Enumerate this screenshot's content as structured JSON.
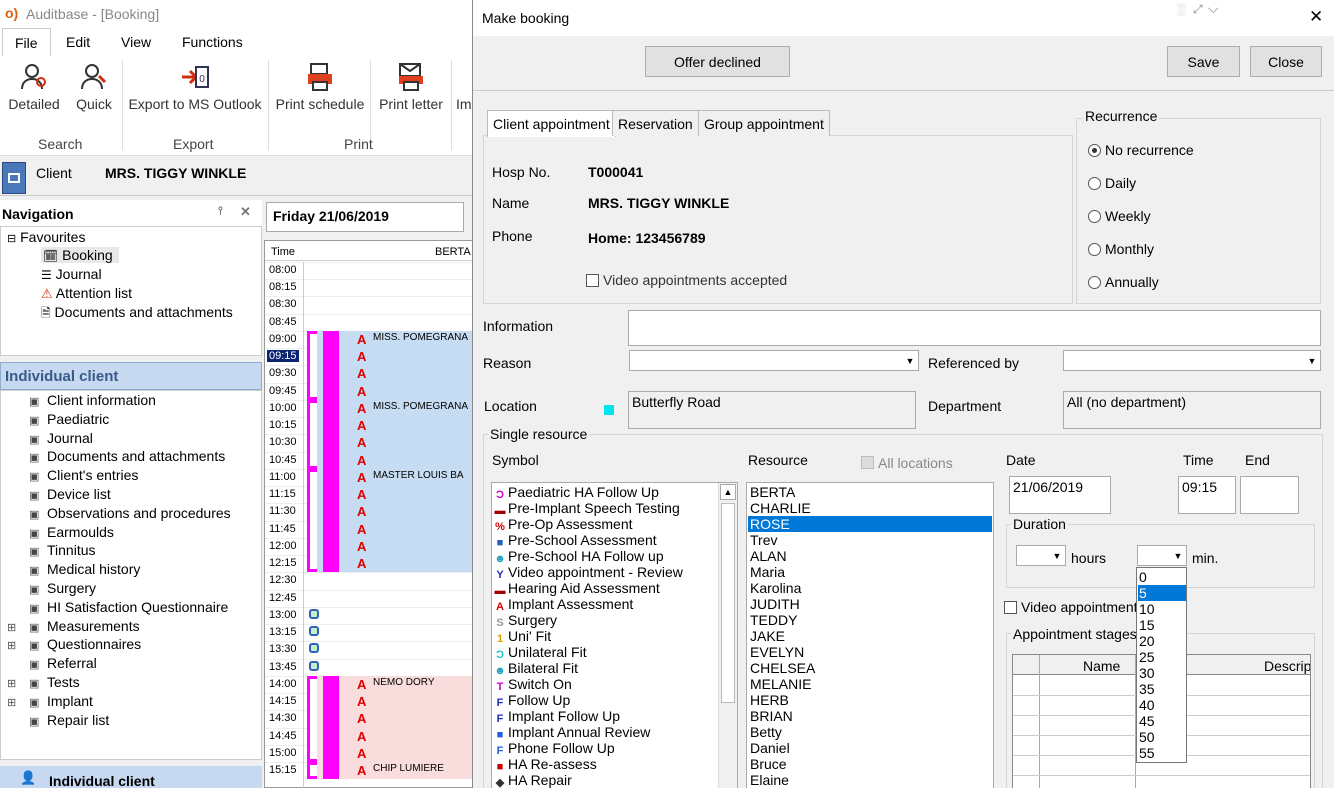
{
  "app": {
    "title": "Auditbase - [Booking]",
    "tabs": [
      "File",
      "Edit",
      "View",
      "Functions"
    ],
    "ribbon": {
      "buttons": [
        {
          "label": "Detailed",
          "icon": "person-search-icon"
        },
        {
          "label": "Quick",
          "icon": "person-quick-search-icon"
        },
        {
          "label": "Export to MS Outlook",
          "icon": "outlook-export-icon"
        },
        {
          "label": "Print schedule",
          "icon": "print-schedule-icon"
        },
        {
          "label": "Print letter",
          "icon": "print-letter-icon"
        },
        {
          "label": "Im",
          "icon": "import-icon"
        }
      ],
      "groups": [
        "Search",
        "Export",
        "Print"
      ]
    },
    "client_label": "Client",
    "client_name": "MRS. TIGGY WINKLE",
    "navigation_title": "Navigation",
    "favourites": {
      "label": "Favourites",
      "items": [
        "Booking",
        "Journal",
        "Attention list",
        "Documents and attachments"
      ]
    },
    "individual_client_title": "Individual client",
    "individual_items": [
      "Client information",
      "Paediatric",
      "Journal",
      "Documents and attachments",
      "Client's entries",
      "Device list",
      "Observations and procedures",
      "Earmoulds",
      "Tinnitus",
      "Medical history",
      "Surgery",
      "HI Satisfaction Questionnaire",
      "Measurements",
      "Questionnaires",
      "Referral",
      "Tests",
      "Implant",
      "Repair list"
    ],
    "footer_label": "Individual client",
    "schedule": {
      "date": "Friday 21/06/2019",
      "time_header": "Time",
      "resource_header": "BERTA",
      "times": [
        "08:00",
        "08:15",
        "08:30",
        "08:45",
        "09:00",
        "09:15",
        "09:30",
        "09:45",
        "10:00",
        "10:15",
        "10:30",
        "10:45",
        "11:00",
        "11:15",
        "11:30",
        "11:45",
        "12:00",
        "12:15",
        "12:30",
        "12:45",
        "13:00",
        "13:15",
        "13:30",
        "13:45",
        "14:00",
        "14:15",
        "14:30",
        "14:45",
        "15:00",
        "15:15"
      ],
      "selected_time": "09:15",
      "appointments": [
        {
          "name": "MISS. POMEGRANA",
          "start": 4,
          "len": 4,
          "color": "#c6dcf2"
        },
        {
          "name": "MISS. POMEGRANA",
          "start": 8,
          "len": 4,
          "color": "#c6dcf2"
        },
        {
          "name": "MASTER LOUIS BA",
          "start": 12,
          "len": 6,
          "color": "#c6dcf2"
        },
        {
          "name": "NEMO DORY",
          "start": 24,
          "len": 5,
          "color": "#f9dcdc"
        },
        {
          "name": "CHIP LUMIERE",
          "start": 29,
          "len": 1,
          "color": "#f9dcdc"
        }
      ]
    }
  },
  "dialog": {
    "title": "Make booking",
    "offer_declined": "Offer declined",
    "save": "Save",
    "close": "Close",
    "tabs": [
      "Client appointment",
      "Reservation",
      "Group appointment"
    ],
    "hosp_no_label": "Hosp No.",
    "hosp_no": "T000041",
    "name_label": "Name",
    "name": "MRS. TIGGY WINKLE",
    "phone_label": "Phone",
    "phone": "Home: 123456789",
    "video_accepted": "Video appointments accepted",
    "recurrence": {
      "title": "Recurrence",
      "options": [
        "No recurrence",
        "Daily",
        "Weekly",
        "Monthly",
        "Annually"
      ],
      "selected": "No recurrence"
    },
    "information_label": "Information",
    "information": "",
    "reason_label": "Reason",
    "reason": "",
    "referenced_by_label": "Referenced by",
    "referenced_by": "",
    "location_label": "Location",
    "location": "Butterfly Road",
    "location_color": "#00e5f0",
    "department_label": "Department",
    "department": "All (no department)",
    "single_resource_label": "Single resource",
    "symbol_label": "Symbol",
    "symbols": [
      {
        "label": "Paediatric HA Follow Up",
        "glyph": "Ɔ",
        "color": "#d000d0"
      },
      {
        "label": "Pre-Implant Speech Testing",
        "glyph": "▬",
        "color": "#a00000"
      },
      {
        "label": "Pre-Op Assessment",
        "glyph": "%",
        "color": "#d00000"
      },
      {
        "label": "Pre-School Assessment",
        "glyph": "■",
        "color": "#2060c0"
      },
      {
        "label": "Pre-School HA Follow up",
        "glyph": "☻",
        "color": "#20a0c0"
      },
      {
        "label": "Video appointment - Review",
        "glyph": "Y",
        "color": "#2030c0"
      },
      {
        "label": "Hearing Aid Assessment",
        "glyph": "▬",
        "color": "#a00000"
      },
      {
        "label": "Implant Assessment",
        "glyph": "A",
        "color": "#e00000"
      },
      {
        "label": "Surgery",
        "glyph": "S",
        "color": "#999999"
      },
      {
        "label": "Uni' Fit",
        "glyph": "1",
        "color": "#e0a000"
      },
      {
        "label": "Unilateral Fit",
        "glyph": "Ɔ",
        "color": "#20c0c0"
      },
      {
        "label": "Bilateral Fit",
        "glyph": "☻",
        "color": "#20a0c0"
      },
      {
        "label": "Switch On",
        "glyph": "T",
        "color": "#d000d0"
      },
      {
        "label": "Follow Up",
        "glyph": "F",
        "color": "#2030c0"
      },
      {
        "label": "Implant Follow Up",
        "glyph": "F",
        "color": "#2030c0"
      },
      {
        "label": "Implant Annual Review",
        "glyph": "■",
        "color": "#2060e0"
      },
      {
        "label": "Phone Follow Up",
        "glyph": "F",
        "color": "#2060e0"
      },
      {
        "label": "HA Re-assess",
        "glyph": "■",
        "color": "#d00000"
      },
      {
        "label": "HA Repair",
        "glyph": "◆",
        "color": "#333333"
      }
    ],
    "resource_label": "Resource",
    "all_locations": "All locations",
    "resources": [
      "BERTA",
      "CHARLIE",
      "ROSE",
      "Trev",
      "ALAN",
      "Maria",
      "Karolina",
      "JUDITH",
      "TEDDY",
      "JAKE",
      "EVELYN",
      "CHELSEA",
      "MELANIE",
      "HERB",
      "BRIAN",
      "Betty",
      "Daniel",
      "Bruce",
      "Elaine"
    ],
    "selected_resource": "ROSE",
    "date_label": "Date",
    "date": "21/06/2019",
    "time_label": "Time",
    "time": "09:15",
    "end_label": "End",
    "end": "",
    "duration_label": "Duration",
    "hours_label": "hours",
    "min_label": "min.",
    "minute_options": [
      "0",
      "5",
      "10",
      "15",
      "20",
      "25",
      "30",
      "35",
      "40",
      "45",
      "50",
      "55"
    ],
    "selected_minute": "5",
    "video_appointment": "Video appointment",
    "appointment_stages": "Appointment stages",
    "stage_columns": [
      "Name",
      "Descrip"
    ]
  }
}
